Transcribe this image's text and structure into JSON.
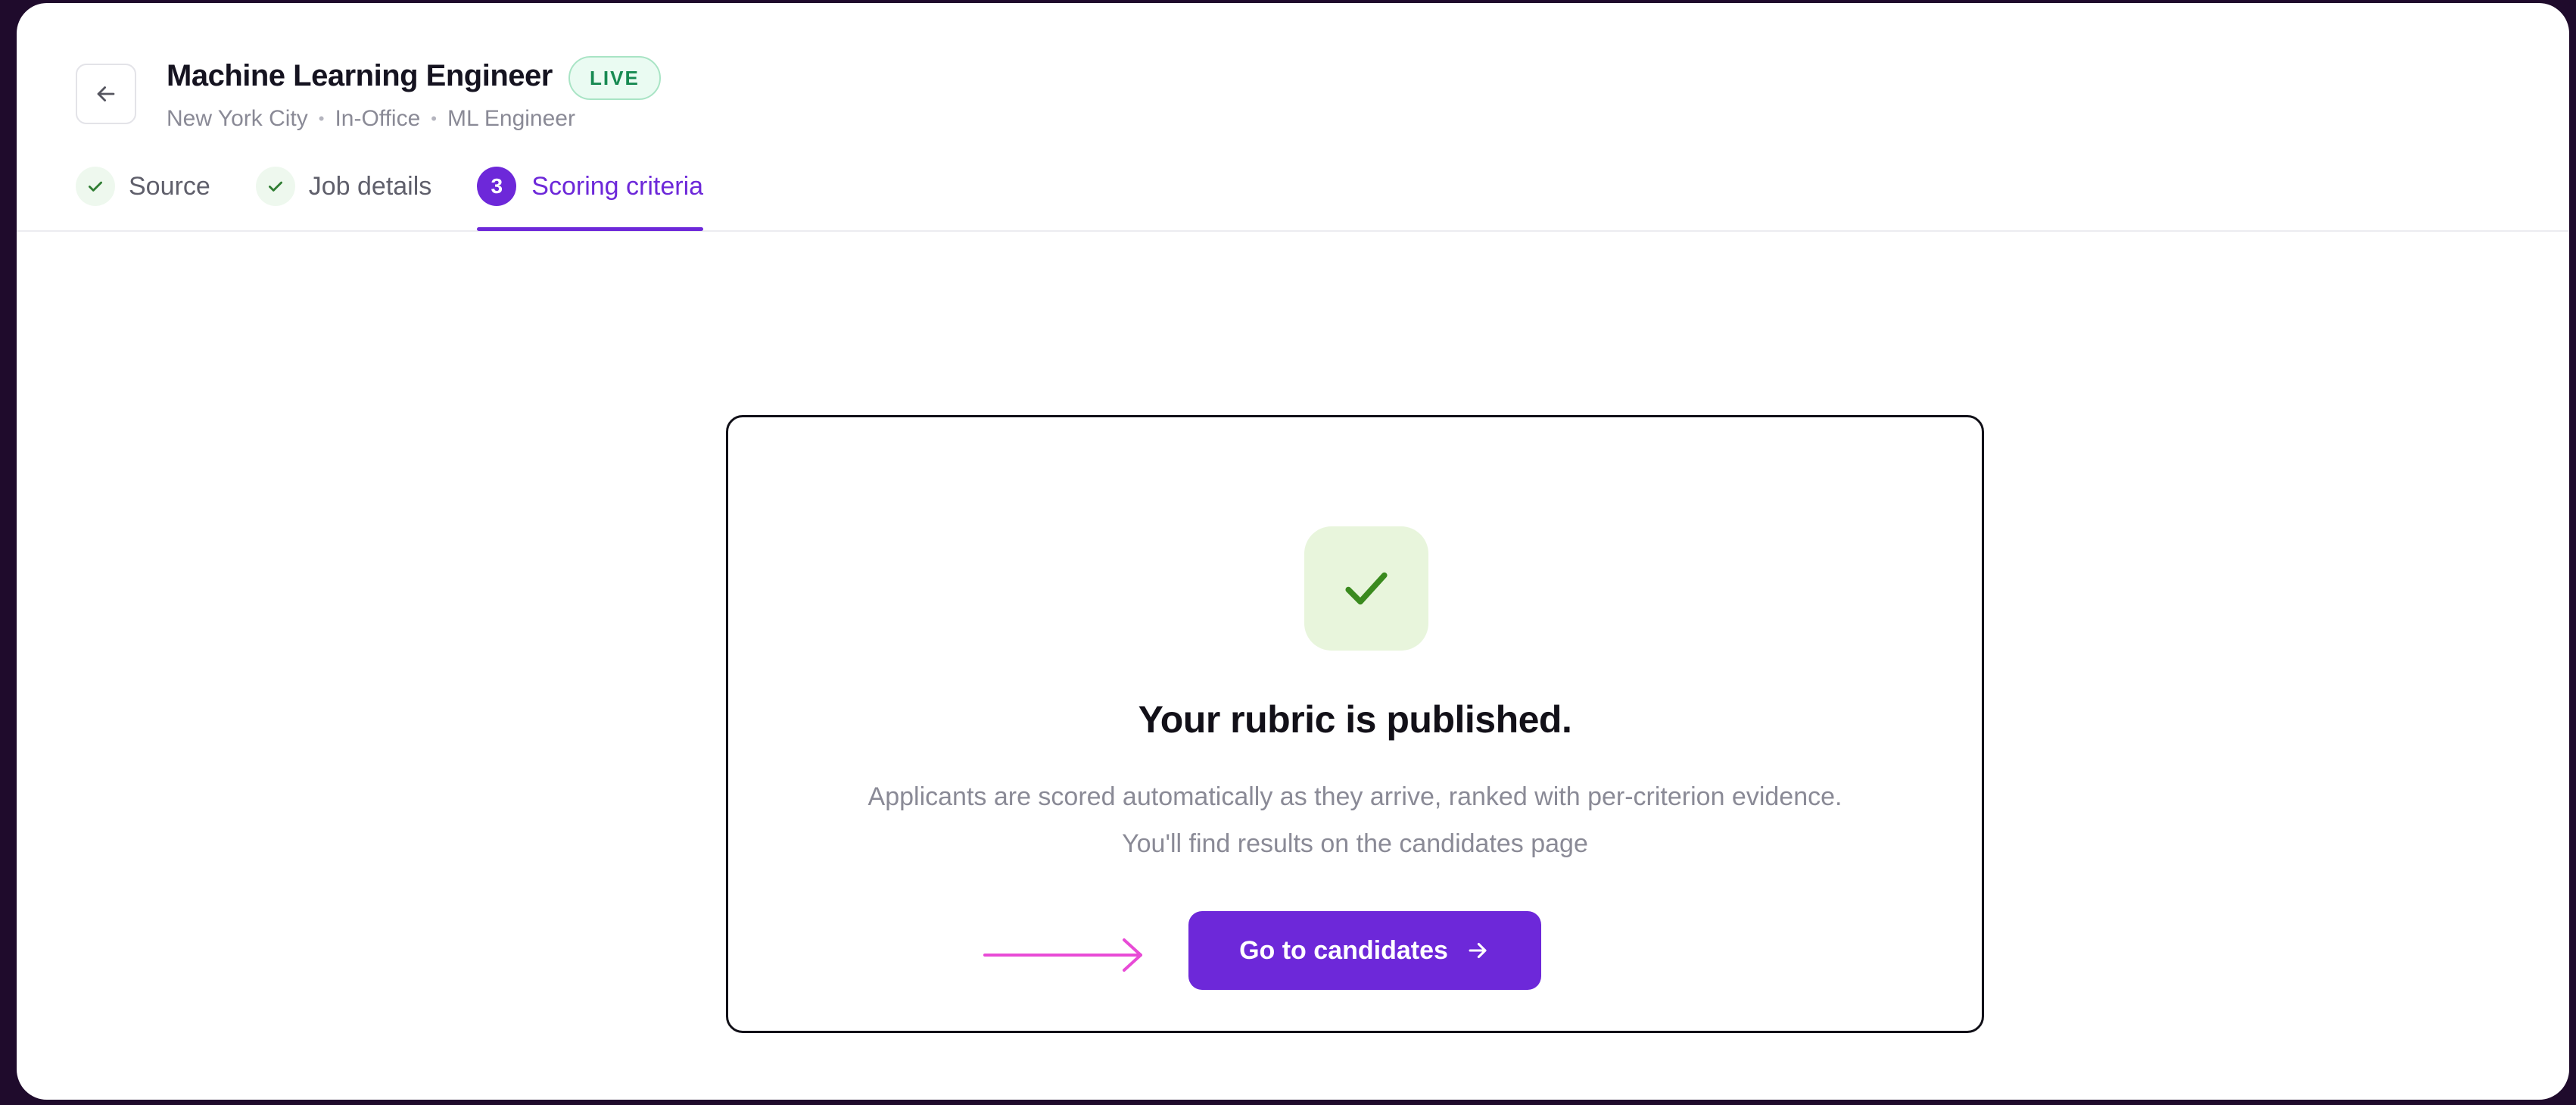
{
  "header": {
    "back_icon": "arrow-left-icon",
    "job_title": "Machine Learning Engineer",
    "status_badge": "LIVE",
    "meta": {
      "location": "New York City",
      "work_mode": "In-Office",
      "role": "ML Engineer",
      "separator": "•"
    }
  },
  "steps": [
    {
      "label": "Source",
      "state": "complete",
      "icon": "check-icon"
    },
    {
      "label": "Job details",
      "state": "complete",
      "icon": "check-icon"
    },
    {
      "label": "Scoring criteria",
      "state": "active",
      "number": "3"
    }
  ],
  "card": {
    "icon": "checkmark-icon",
    "title": "Your rubric is published.",
    "description_line1": "Applicants are scored automatically as they arrive, ranked with per-criterion evidence.",
    "description_line2": "You'll find results on the candidates page",
    "cta_label": "Go to candidates",
    "cta_icon": "arrow-right-icon",
    "pointer_icon": "annotation-arrow-icon"
  },
  "colors": {
    "accent": "#6d28d9",
    "live_green": "#178a52",
    "success_bg": "#e8f5dc",
    "success_check": "#3a8a1e",
    "annotation_pink": "#e84bd6",
    "frame": "#1f0b2c"
  }
}
